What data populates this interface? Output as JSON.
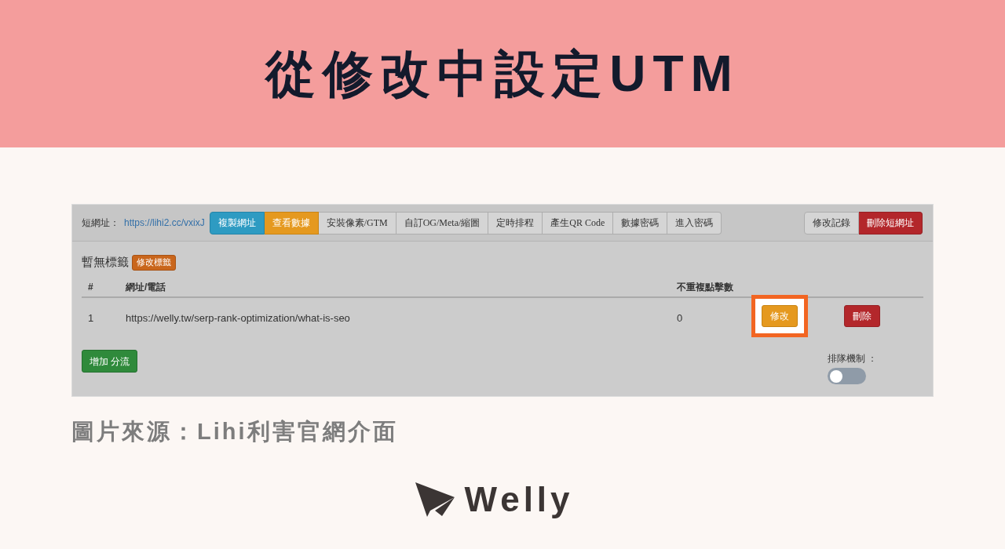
{
  "header": {
    "title": "從修改中設定UTM"
  },
  "screenshot": {
    "short_url": {
      "label": "短網址：",
      "link": "https://lihi2.cc/vxixJ"
    },
    "toolbar": [
      {
        "label": "複製網址",
        "kind": "info"
      },
      {
        "label": "查看數據",
        "kind": "warning"
      },
      {
        "label": "安裝像素/GTM",
        "kind": "default"
      },
      {
        "label": "自訂OG/Meta/縮圖",
        "kind": "default"
      },
      {
        "label": "定時排程",
        "kind": "default"
      },
      {
        "label": "產生QR Code",
        "kind": "default"
      },
      {
        "label": "數據密碼",
        "kind": "default"
      },
      {
        "label": "進入密碼",
        "kind": "default"
      }
    ],
    "actions": [
      {
        "label": "修改記錄",
        "kind": "default"
      },
      {
        "label": "刪除短網址",
        "kind": "danger"
      }
    ],
    "tags": {
      "text": "暫無標籤",
      "button": {
        "label": "修改標籤",
        "kind": "accent"
      }
    },
    "table": {
      "columns": [
        "#",
        "網址/電話",
        "不重複點擊數"
      ],
      "rows": [
        {
          "cells": [
            "1",
            "https://welly.tw/serp-rank-optimization/what-is-seo",
            "0"
          ],
          "buttons": [
            {
              "label": "修改",
              "kind": "warning",
              "highlighted": true
            },
            {
              "label": "刪除",
              "kind": "danger",
              "highlighted": false
            }
          ]
        }
      ]
    },
    "add_button": {
      "label": "增加 分流",
      "kind": "success"
    },
    "queue": {
      "label": "排隊機制 ：",
      "on": false
    }
  },
  "caption": "圖片來源：Lihi利害官網介面",
  "logo": {
    "text": "Welly"
  }
}
